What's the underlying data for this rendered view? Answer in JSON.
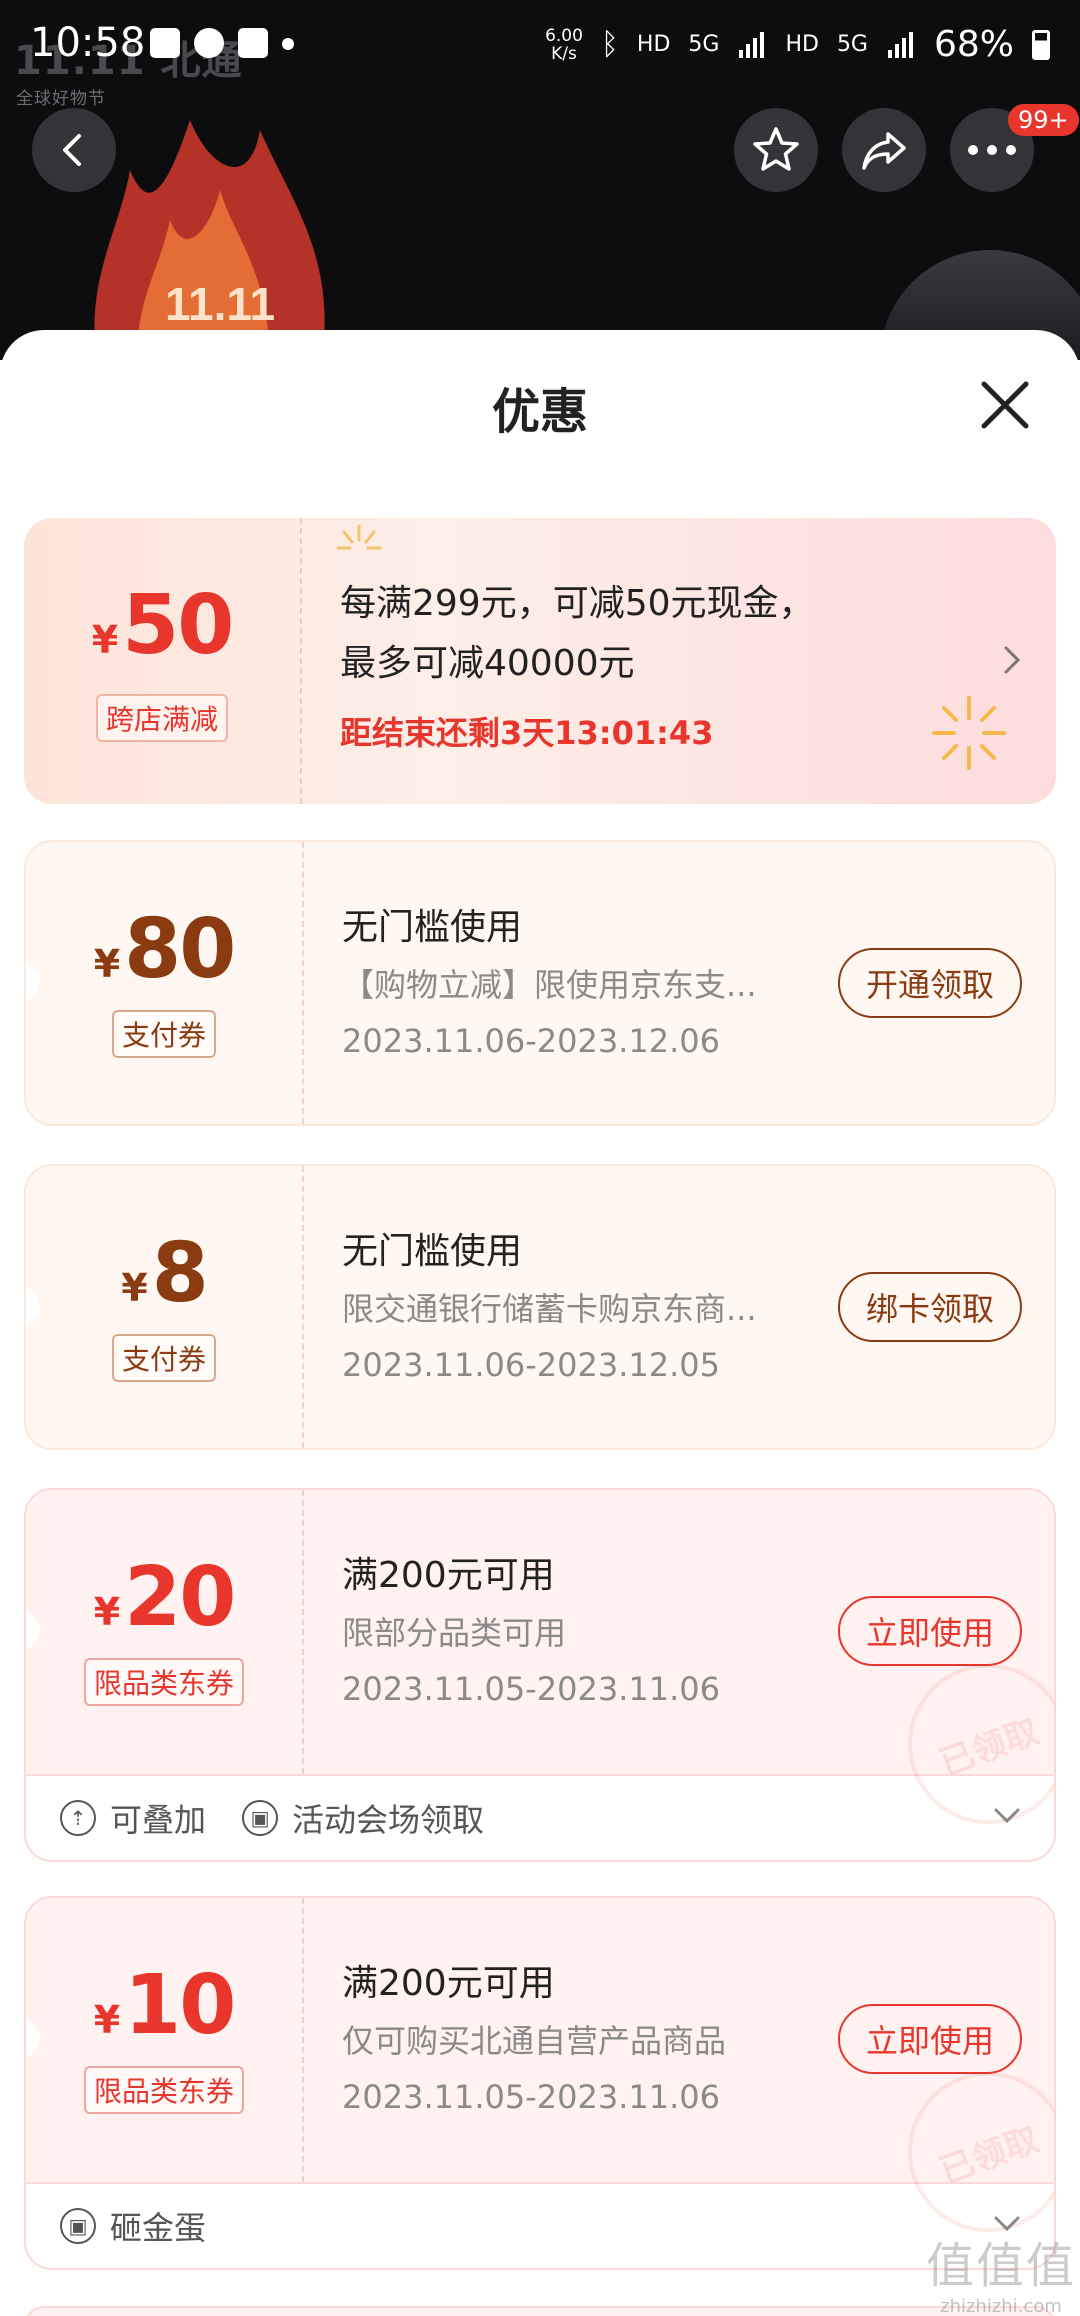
{
  "status_bar": {
    "time": "10:58",
    "net_speed": "6.00",
    "net_unit": "K/s",
    "hd1": "HD",
    "net1": "5G",
    "hd2": "HD",
    "net2": "5G",
    "battery": "68%"
  },
  "hero": {
    "brand_logo": "11.11 北通",
    "brand_sub": "全球好物节"
  },
  "header": {
    "badge": "99+"
  },
  "sheet": {
    "title": "优惠"
  },
  "cards": [
    {
      "currency": "¥",
      "amount": "50",
      "tag": "跨店满减",
      "line1": "每满299元，可减50元现金，",
      "line2": "最多可减40000元",
      "countdown": "距结束还剩3天13:01:43"
    },
    {
      "currency": "¥",
      "amount": "80",
      "tag": "支付券",
      "title": "无门槛使用",
      "desc": "【购物立减】限使用京东支...",
      "date": "2023.11.06-2023.12.06",
      "action": "开通领取"
    },
    {
      "currency": "¥",
      "amount": "8",
      "tag": "支付券",
      "title": "无门槛使用",
      "desc": "限交通银行储蓄卡购京东商...",
      "date": "2023.11.06-2023.12.05",
      "action": "绑卡领取"
    },
    {
      "currency": "¥",
      "amount": "20",
      "tag": "限品类东券",
      "title": "满200元可用",
      "desc": "限部分品类可用",
      "date": "2023.11.05-2023.11.06",
      "action": "立即使用",
      "stamp": "已领取",
      "footer": [
        "可叠加",
        "活动会场领取"
      ]
    },
    {
      "currency": "¥",
      "amount": "10",
      "tag": "限品类东券",
      "title": "满200元可用",
      "desc": "仅可购买北通自营产品商品",
      "date": "2023.11.05-2023.11.06",
      "action": "立即使用",
      "stamp": "已领取",
      "footer": [
        "砸金蛋"
      ]
    }
  ],
  "watermark": {
    "big": "值值值",
    "small": "zhizhizhi.com"
  },
  "icons": {
    "back": "chevron-left-icon",
    "favorite": "star-icon",
    "share": "share-arrow-icon",
    "more": "more-dots-icon",
    "close": "close-icon"
  },
  "colors": {
    "accent_red": "#e8362d",
    "pay_brown": "#8a3b12",
    "dark_bg": "#0d0d10"
  }
}
